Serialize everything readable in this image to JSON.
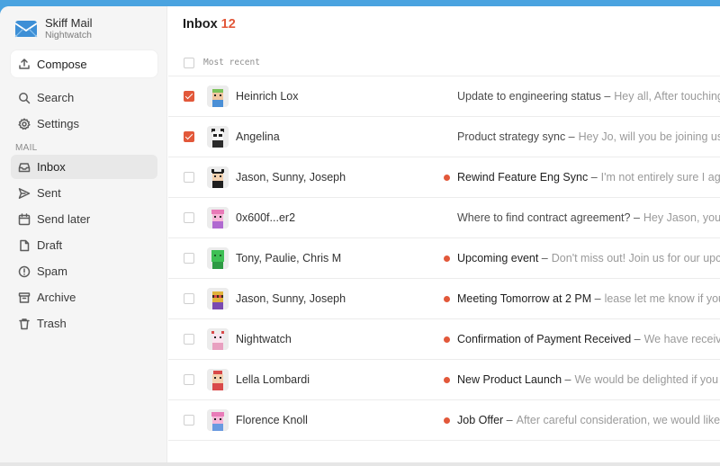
{
  "account": {
    "name": "Skiff Mail",
    "subtitle": "Nightwatch"
  },
  "sidebar": {
    "compose_label": "Compose",
    "top_items": [
      {
        "label": "Search",
        "icon": "search-icon"
      },
      {
        "label": "Settings",
        "icon": "gear-icon"
      }
    ],
    "section_label": "MAIL",
    "mail_items": [
      {
        "label": "Inbox",
        "icon": "inbox-icon",
        "active": true
      },
      {
        "label": "Sent",
        "icon": "send-icon"
      },
      {
        "label": "Send later",
        "icon": "calendar-icon"
      },
      {
        "label": "Draft",
        "icon": "file-icon"
      },
      {
        "label": "Spam",
        "icon": "alert-icon"
      },
      {
        "label": "Archive",
        "icon": "archive-icon"
      },
      {
        "label": "Trash",
        "icon": "trash-icon"
      }
    ]
  },
  "inbox": {
    "title": "Inbox",
    "count": "12",
    "sort_label": "Most recent",
    "messages": [
      {
        "checked": true,
        "unread": false,
        "sender": "Heinrich Lox",
        "subject": "Update to engineering status",
        "preview": "Hey all, After touching base",
        "avatar_color": "#7cc35a"
      },
      {
        "checked": true,
        "unread": false,
        "sender": "Angelina",
        "subject": "Product strategy sync",
        "preview": "Hey Jo, will you be joining us",
        "avatar_color": "#2b2b2b"
      },
      {
        "checked": false,
        "unread": true,
        "sender": "Jason, Sunny, Joseph",
        "subject": "Rewind Feature Eng Sync",
        "preview": "I'm not entirely sure I agree",
        "avatar_color": "#1f1f1f"
      },
      {
        "checked": false,
        "unread": false,
        "sender": "0x600f...er2",
        "subject": "Where to find contract agreement?",
        "preview": "Hey Jason, you",
        "avatar_color": "#e87bb8"
      },
      {
        "checked": false,
        "unread": true,
        "sender": "Tony, Paulie, Chris M",
        "subject": "Upcoming event",
        "preview": "Don't miss out! Join us for our upcoming",
        "avatar_color": "#3fbf55"
      },
      {
        "checked": false,
        "unread": true,
        "sender": "Jason, Sunny, Joseph",
        "subject": "Meeting Tomorrow at 2 PM",
        "preview": "lease let me know if you",
        "avatar_color": "#e0b33a"
      },
      {
        "checked": false,
        "unread": true,
        "sender": "Nightwatch",
        "subject": "Confirmation of Payment Received",
        "preview": "We have received",
        "avatar_color": "#e8a0c0"
      },
      {
        "checked": false,
        "unread": true,
        "sender": "Lella Lombardi",
        "subject": "New Product Launch",
        "preview": "We would be delighted if you",
        "avatar_color": "#d94a4a"
      },
      {
        "checked": false,
        "unread": true,
        "sender": "Florence Knoll",
        "subject": "Job Offer",
        "preview": "After careful consideration, we would like",
        "avatar_color": "#e87bb8"
      }
    ]
  },
  "colors": {
    "accent": "#e2583a",
    "sidebar_bg": "#f5f5f5",
    "desktop_bg": "#4aa3e0"
  }
}
